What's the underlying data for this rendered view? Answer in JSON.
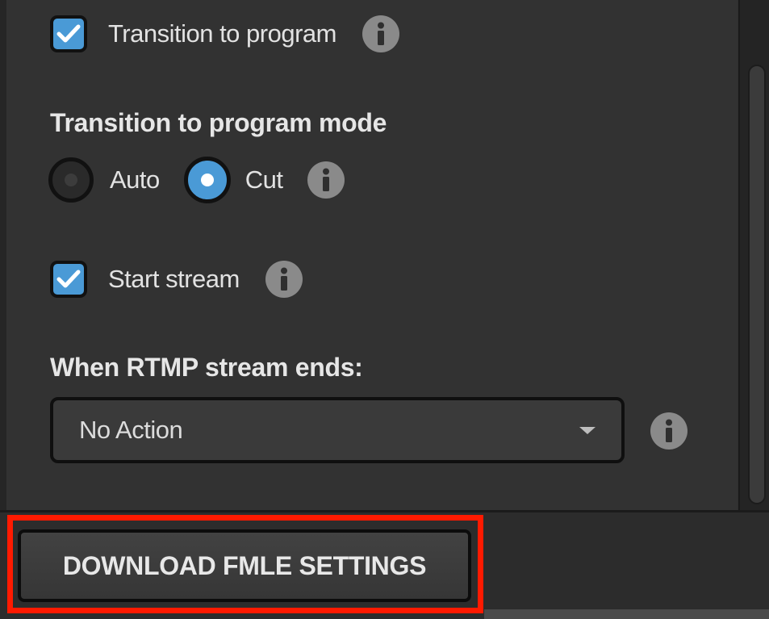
{
  "options": {
    "transition_to_program": {
      "label": "Transition to program",
      "checked": true
    },
    "start_stream": {
      "label": "Start stream",
      "checked": true
    }
  },
  "transition_mode": {
    "heading": "Transition to program mode",
    "options": [
      {
        "label": "Auto",
        "selected": false
      },
      {
        "label": "Cut",
        "selected": true
      }
    ]
  },
  "rtmp_end": {
    "heading": "When RTMP stream ends:",
    "selected_value": "No Action"
  },
  "footer": {
    "download_button_label": "DOWNLOAD FMLE SETTINGS"
  },
  "colors": {
    "accent": "#4a9ad6",
    "highlight": "#ff1a00",
    "panel_bg": "#323232"
  },
  "icons": {
    "info": "info-icon",
    "check": "check-icon",
    "caret": "chevron-down-icon"
  }
}
